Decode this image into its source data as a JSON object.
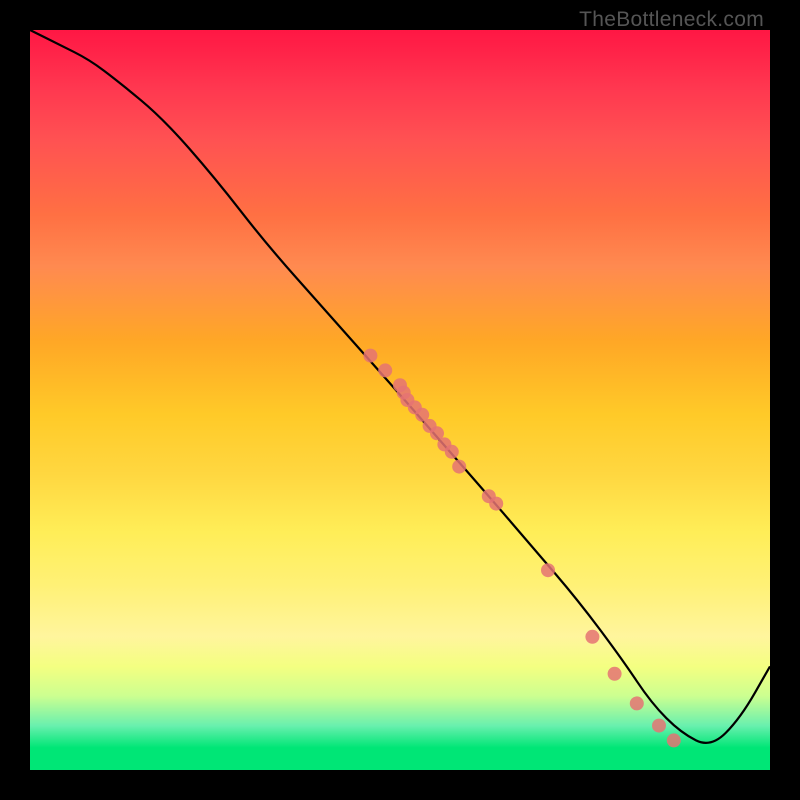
{
  "watermark": "TheBottleneck.com",
  "chart_data": {
    "type": "line",
    "title": "",
    "xlabel": "",
    "ylabel": "",
    "xlim": [
      0,
      100
    ],
    "ylim": [
      0,
      100
    ],
    "curve": {
      "x": [
        0,
        4,
        8,
        12,
        18,
        25,
        32,
        40,
        48,
        55,
        62,
        68,
        74,
        80,
        84,
        88,
        92,
        96,
        100
      ],
      "y": [
        100,
        98,
        96,
        93,
        88,
        80,
        71,
        62,
        53,
        45,
        37,
        30,
        23,
        15,
        9,
        5,
        3,
        7,
        14
      ]
    },
    "scatter": {
      "x": [
        46,
        48,
        50,
        50.5,
        51,
        52,
        53,
        54,
        55,
        56,
        57,
        58,
        62,
        63,
        70,
        76,
        79,
        82,
        85,
        87
      ],
      "y": [
        56,
        54,
        52,
        51,
        50,
        49,
        48,
        46.5,
        45.5,
        44,
        43,
        41,
        37,
        36,
        27,
        18,
        13,
        9,
        6,
        4
      ]
    },
    "dot_color": "#e57373",
    "gradient": [
      "#ff1744",
      "#ffca28",
      "#fff176",
      "#00e676"
    ]
  }
}
